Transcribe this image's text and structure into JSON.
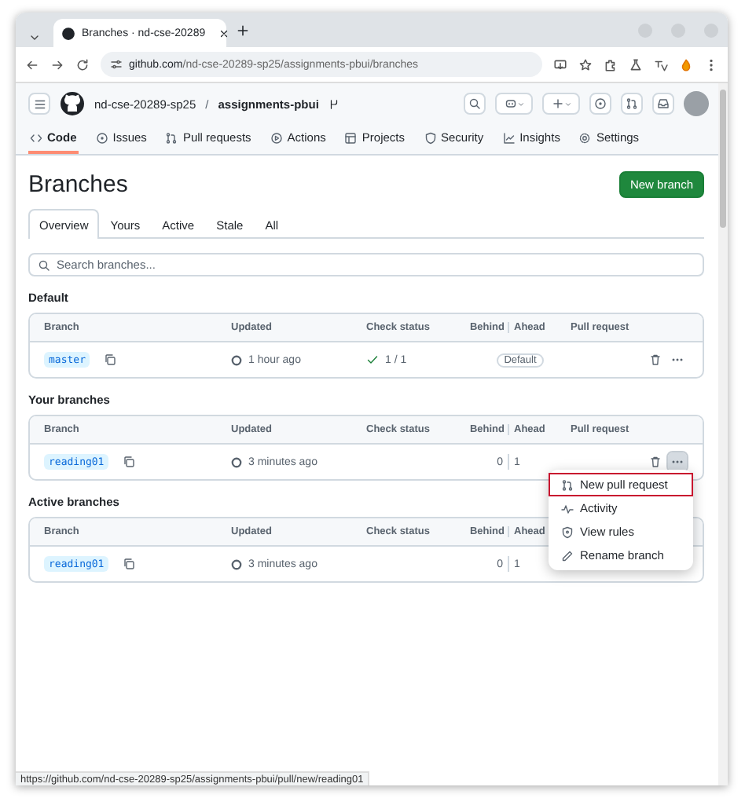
{
  "browser": {
    "tab_title": "Branches · nd-cse-20289",
    "url_host": "github.com",
    "url_path": "/nd-cse-20289-sp25/assignments-pbui/branches"
  },
  "repo_header": {
    "owner": "nd-cse-20289-sp25",
    "separator": "/",
    "repo": "assignments-pbui"
  },
  "repo_nav": [
    {
      "label": "Code",
      "selected": true
    },
    {
      "label": "Issues",
      "selected": false
    },
    {
      "label": "Pull requests",
      "selected": false
    },
    {
      "label": "Actions",
      "selected": false
    },
    {
      "label": "Projects",
      "selected": false
    },
    {
      "label": "Security",
      "selected": false
    },
    {
      "label": "Insights",
      "selected": false
    },
    {
      "label": "Settings",
      "selected": false
    }
  ],
  "page": {
    "title": "Branches",
    "new_button": "New branch"
  },
  "filter_tabs": [
    {
      "label": "Overview",
      "selected": true
    },
    {
      "label": "Yours",
      "selected": false
    },
    {
      "label": "Active",
      "selected": false
    },
    {
      "label": "Stale",
      "selected": false
    },
    {
      "label": "All",
      "selected": false
    }
  ],
  "search": {
    "placeholder": "Search branches..."
  },
  "sections": [
    {
      "heading": "Default",
      "columns": [
        "Branch",
        "Updated",
        "Check status",
        "Behind",
        "Ahead",
        "Pull request"
      ],
      "rows": [
        {
          "kind": "default",
          "branch": "master",
          "updated": "1 hour ago",
          "check": "1 / 1",
          "badge": "Default",
          "menu_open": false
        }
      ]
    },
    {
      "heading": "Your branches",
      "columns": [
        "Branch",
        "Updated",
        "Check status",
        "Behind",
        "Ahead",
        "Pull request"
      ],
      "rows": [
        {
          "kind": "compare",
          "branch": "reading01",
          "updated": "3 minutes ago",
          "behind": "0",
          "ahead": "1",
          "menu_open": true
        }
      ]
    },
    {
      "heading": "Active branches",
      "columns": [
        "Branch",
        "Updated",
        "Check status",
        "Behind",
        "Ahead"
      ],
      "rows": [
        {
          "kind": "compare",
          "branch": "reading01",
          "updated": "3 minutes ago",
          "behind": "0",
          "ahead": "1"
        }
      ]
    }
  ],
  "context_menu": {
    "items": [
      {
        "label": "New pull request",
        "highlighted": true
      },
      {
        "label": "Activity",
        "highlighted": false
      },
      {
        "label": "View rules",
        "highlighted": false
      },
      {
        "label": "Rename branch",
        "highlighted": false
      }
    ]
  },
  "status_bar": "https://github.com/nd-cse-20289-sp25/assignments-pbui/pull/new/reading01"
}
